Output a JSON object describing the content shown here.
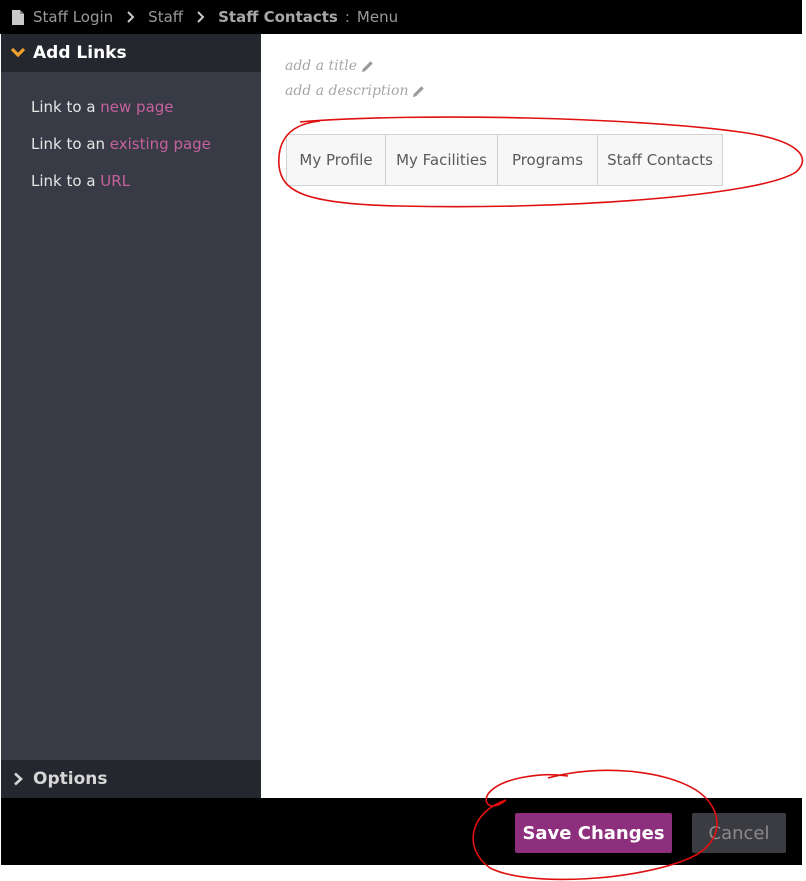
{
  "breadcrumb": {
    "items": [
      "Staff Login",
      "Staff"
    ],
    "current": "Staff Contacts",
    "separator": ":",
    "suffix": "Menu"
  },
  "sidebar": {
    "header": "Add Links",
    "links": [
      {
        "prefix": "Link to a ",
        "accent": "new page"
      },
      {
        "prefix": "Link to an ",
        "accent": "existing page"
      },
      {
        "prefix": "Link to a ",
        "accent": "URL"
      }
    ],
    "options_label": "Options"
  },
  "content": {
    "title_placeholder": "add a title",
    "description_placeholder": "add a description",
    "menu_items": [
      "My Profile",
      "My Facilities",
      "Programs",
      "Staff Contacts"
    ]
  },
  "actions": {
    "save_label": "Save Changes",
    "cancel_label": "Cancel"
  },
  "icons": {
    "page": "document-icon",
    "breadcrumb_chevron": "chevron-right-icon",
    "expanded": "chevron-down-icon",
    "collapsed": "chevron-right-icon",
    "edit": "pencil-icon"
  },
  "colors": {
    "accent_link": "#c5619f",
    "save_button": "#8e2f7e",
    "header_arrow": "#f0a030",
    "annotation": "#e01010"
  }
}
